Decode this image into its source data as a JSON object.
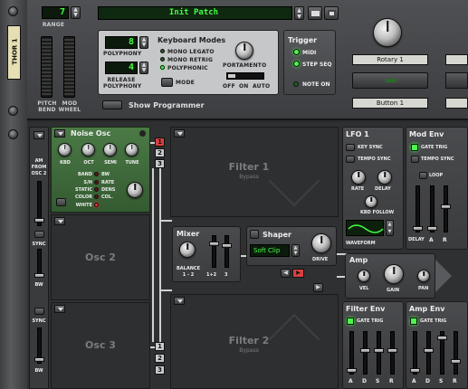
{
  "colors": {
    "lcd_text": "#43ff43",
    "panel": "#3b3c3e",
    "noise_green": "#3f6b3a",
    "led_red": "#ff3030",
    "led_green": "#4df54d"
  },
  "device": {
    "name_tag": "THOR 1"
  },
  "top": {
    "range_label": "RANGE",
    "range_value": "7",
    "patch_name": "Init Patch",
    "pitch_bend_label": "PITCH\nBEND",
    "mod_wheel_label": "MOD\nWHEEL",
    "polyphony_value": "8",
    "polyphony_label": "POLYPHONY",
    "release_poly_value": "4",
    "release_poly_label": "RELEASE\nPOLYPHONY",
    "keyboard_modes_title": "Keyboard Modes",
    "keyboard_modes": [
      "MONO LEGATO",
      "MONO RETRIG",
      "POLYPHONIC"
    ],
    "portamento_label": "PORTAMENTO",
    "mode_label": "MODE",
    "porta_options": [
      "OFF",
      "ON",
      "AUTO"
    ],
    "trigger_title": "Trigger",
    "trigger_items": [
      "MIDI",
      "STEP SEQ"
    ],
    "note_on_label": "NOTE ON",
    "rotary1_label": "Rotary 1",
    "button1_label": "Button 1",
    "show_programmer_label": "Show Programmer"
  },
  "osc": {
    "noise_title": "Noise Osc",
    "knobs": [
      "KBD",
      "OCT",
      "SEMI",
      "TUNE"
    ],
    "noise_modes": [
      "BAND",
      "S/H",
      "STATIC",
      "COLOR",
      "WHITE"
    ],
    "noise_params": [
      "BW",
      "RATE",
      "DENS",
      "COL."
    ],
    "am_label": "AM\nFROM\nOSC 2",
    "sync_label": "SYNC",
    "bw_label": "BW",
    "osc2_title": "Osc 2",
    "osc3_title": "Osc 3"
  },
  "routing": {
    "buttons_top": [
      "1",
      "2",
      "3"
    ],
    "buttons_bottom": [
      "1",
      "2",
      "3"
    ]
  },
  "filter1": {
    "title": "Filter 1",
    "sub": "Bypass"
  },
  "filter2": {
    "title": "Filter 2",
    "sub": "Bypass"
  },
  "mixer": {
    "title": "Mixer",
    "balance_label": "BALANCE\n1 - 2",
    "fader_labels": [
      "1+2",
      "3"
    ]
  },
  "shaper": {
    "title": "Shaper",
    "mode": "Soft Clip",
    "drive_label": "DRIVE"
  },
  "amp": {
    "title": "Amp",
    "knobs": [
      "VEL",
      "GAIN",
      "PAN"
    ]
  },
  "lfo1": {
    "title": "LFO 1",
    "toggles": [
      "KEY SYNC",
      "TEMPO SYNC"
    ],
    "rate_label": "RATE",
    "delay_label": "DELAY",
    "kbd_follow_label": "KBD FOLLOW",
    "waveform_label": "WAVEFORM"
  },
  "mod_env": {
    "title": "Mod Env",
    "toggles": [
      "GATE TRIG",
      "TEMPO SYNC"
    ],
    "loop_label": "LOOP",
    "fader_labels": [
      "DELAY",
      "A",
      "R"
    ]
  },
  "filter_env": {
    "title": "Filter Env",
    "gate_label": "GATE TRIG",
    "fader_labels": [
      "A",
      "D",
      "S",
      "R"
    ]
  },
  "amp_env": {
    "title": "Amp Env",
    "gate_label": "GATE TRIG",
    "fader_labels": [
      "A",
      "D",
      "S",
      "R"
    ]
  }
}
